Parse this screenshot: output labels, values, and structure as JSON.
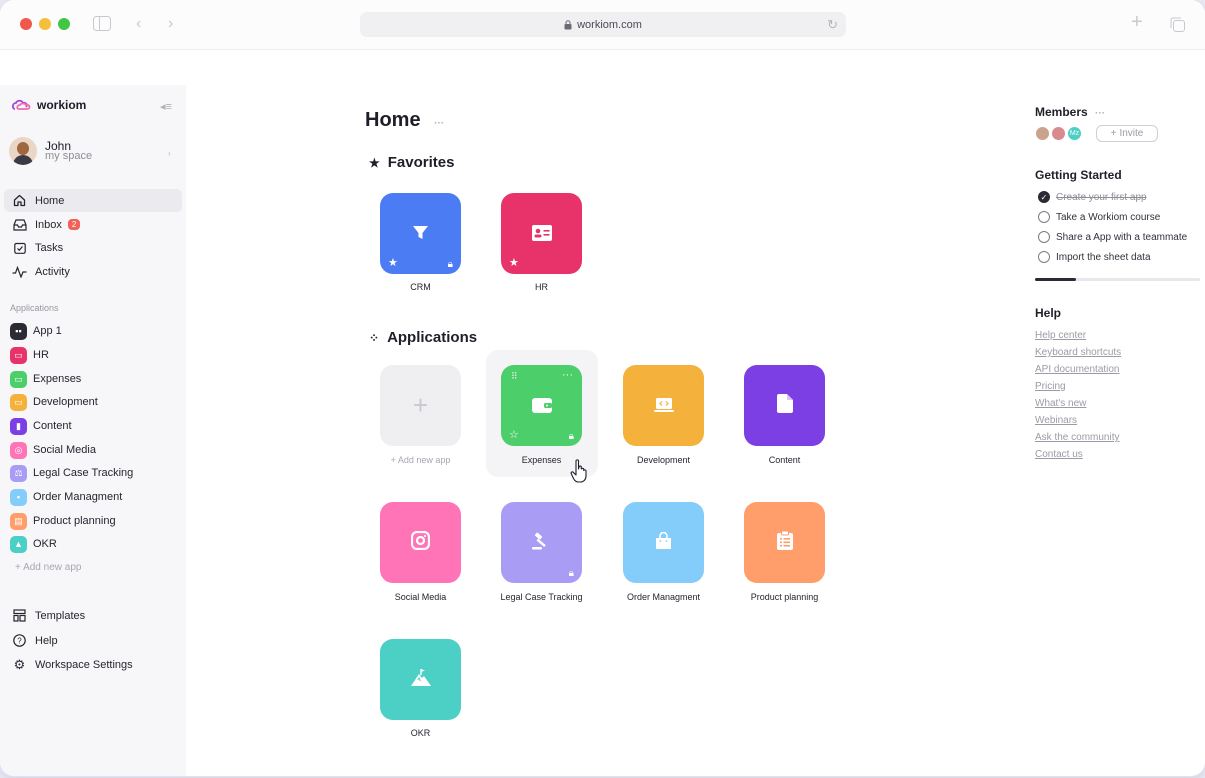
{
  "browser": {
    "url": "workiom.com",
    "colors": {
      "close": "#f0584e",
      "minimize": "#f5be3b",
      "maximize": "#42c744"
    }
  },
  "sidebar": {
    "brand": "workiom",
    "user": {
      "name": "John",
      "subtitle": "my space"
    },
    "nav": [
      {
        "label": "Home",
        "icon": "home-icon",
        "active": true
      },
      {
        "label": "Inbox",
        "icon": "inbox-icon",
        "badge": "2"
      },
      {
        "label": "Tasks",
        "icon": "tasks-icon"
      },
      {
        "label": "Activity",
        "icon": "activity-icon"
      }
    ],
    "applications_label": "Applications",
    "apps": [
      {
        "label": "App 1",
        "color": "#2b2b35",
        "icon": "grid-icon"
      },
      {
        "label": "HR",
        "color": "#e8336a",
        "icon": "id-card-icon"
      },
      {
        "label": "Expenses",
        "color": "#4cce6a",
        "icon": "wallet-icon"
      },
      {
        "label": "Development",
        "color": "#f4b23d",
        "icon": "code-icon"
      },
      {
        "label": "Content",
        "color": "#7b3fe4",
        "icon": "document-icon"
      },
      {
        "label": "Social Media",
        "color": "#ff73b7",
        "icon": "instagram-icon"
      },
      {
        "label": "Legal Case Tracking",
        "color": "#a89cf5",
        "icon": "gavel-icon"
      },
      {
        "label": "Order Managment",
        "color": "#84cdfa",
        "icon": "bag-icon"
      },
      {
        "label": "Product planning",
        "color": "#ff9e6a",
        "icon": "clipboard-icon"
      },
      {
        "label": "OKR",
        "color": "#4ccfc4",
        "icon": "mountain-icon"
      }
    ],
    "add_app": "Add new app",
    "bottom": [
      {
        "label": "Templates",
        "icon": "templates-icon"
      },
      {
        "label": "Help",
        "icon": "help-icon"
      },
      {
        "label": "Workspace Settings",
        "icon": "settings-icon"
      }
    ]
  },
  "main": {
    "title": "Home",
    "favorites_title": "Favorites",
    "favorites": [
      {
        "label": "CRM",
        "color": "#4b7cf3",
        "icon": "funnel-icon"
      },
      {
        "label": "HR",
        "color": "#e8336a",
        "icon": "id-card-icon"
      }
    ],
    "applications_title": "Applications",
    "add_new_app": "Add new app",
    "apps": [
      {
        "label": "Expenses",
        "color": "#4cce6a",
        "icon": "wallet-icon"
      },
      {
        "label": "Development",
        "color": "#f4b23d",
        "icon": "code-icon"
      },
      {
        "label": "Content",
        "color": "#7b3fe4",
        "icon": "document-icon"
      },
      {
        "label": "Social Media",
        "color": "#ff73b7",
        "icon": "instagram-icon"
      },
      {
        "label": "Legal Case Tracking",
        "color": "#a89cf5",
        "icon": "gavel-icon"
      },
      {
        "label": "Order Managment",
        "color": "#84cdfa",
        "icon": "bag-icon"
      },
      {
        "label": "Product planning",
        "color": "#ff9e6a",
        "icon": "clipboard-icon"
      },
      {
        "label": "OKR",
        "color": "#4ccfc4",
        "icon": "mountain-icon"
      }
    ]
  },
  "right_panel": {
    "members_title": "Members",
    "member_initials": "Mz",
    "invite_label": "Invite",
    "getting_started_title": "Getting Started",
    "checklist": [
      {
        "label": "Create your first app",
        "done": true
      },
      {
        "label": "Take a Workiom course",
        "done": false
      },
      {
        "label": "Share a App with a teammate",
        "done": false
      },
      {
        "label": "Import the sheet data",
        "done": false
      }
    ],
    "progress_fraction": 0.25,
    "help_title": "Help",
    "help_links": [
      "Help center",
      "Keyboard shortcuts",
      "API documentation",
      "Pricing",
      "What's new",
      "Webinars",
      "Ask the community",
      "Contact us"
    ]
  }
}
